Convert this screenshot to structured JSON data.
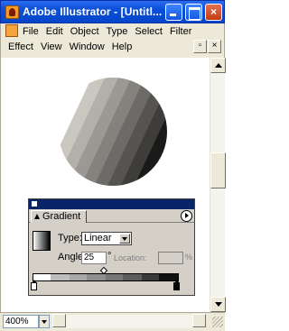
{
  "window": {
    "title": "Adobe Illustrator - [Untitl...",
    "controls": {
      "minimize": "",
      "maximize": "",
      "close": "×"
    }
  },
  "menubar": {
    "row1": [
      "File",
      "Edit",
      "Object",
      "Type",
      "Select",
      "Filter"
    ],
    "row2": [
      "Effect",
      "View",
      "Window",
      "Help"
    ],
    "mdi_controls": {
      "restore": "▫",
      "close": "×"
    }
  },
  "canvas": {
    "shape": "circle-with-linear-gradient-stripes",
    "stripe_colors": [
      "#ffffff",
      "#c9c7c0",
      "#b2b0a9",
      "#9b9993",
      "#84827d",
      "#6c6b67",
      "#555450",
      "#3e3d3a",
      "#1a1a1a"
    ],
    "gradient_angle_degrees": 25
  },
  "panel": {
    "title": "Gradient",
    "type_label": "Type:",
    "type_value": "Linear",
    "angle_label": "Angle:",
    "angle_value": "25",
    "angle_unit": "°",
    "location_label": "Location:",
    "location_value": "",
    "location_unit": "%",
    "ramp_stops": [
      "#ffffff",
      "#000000"
    ],
    "midpoint_percent": 50
  },
  "status": {
    "zoom": "400%"
  },
  "icons": {
    "app_icon": "illustrator-icon",
    "doc_icon": "document-icon",
    "panel_menu": "panel-menu-arrow-icon"
  }
}
